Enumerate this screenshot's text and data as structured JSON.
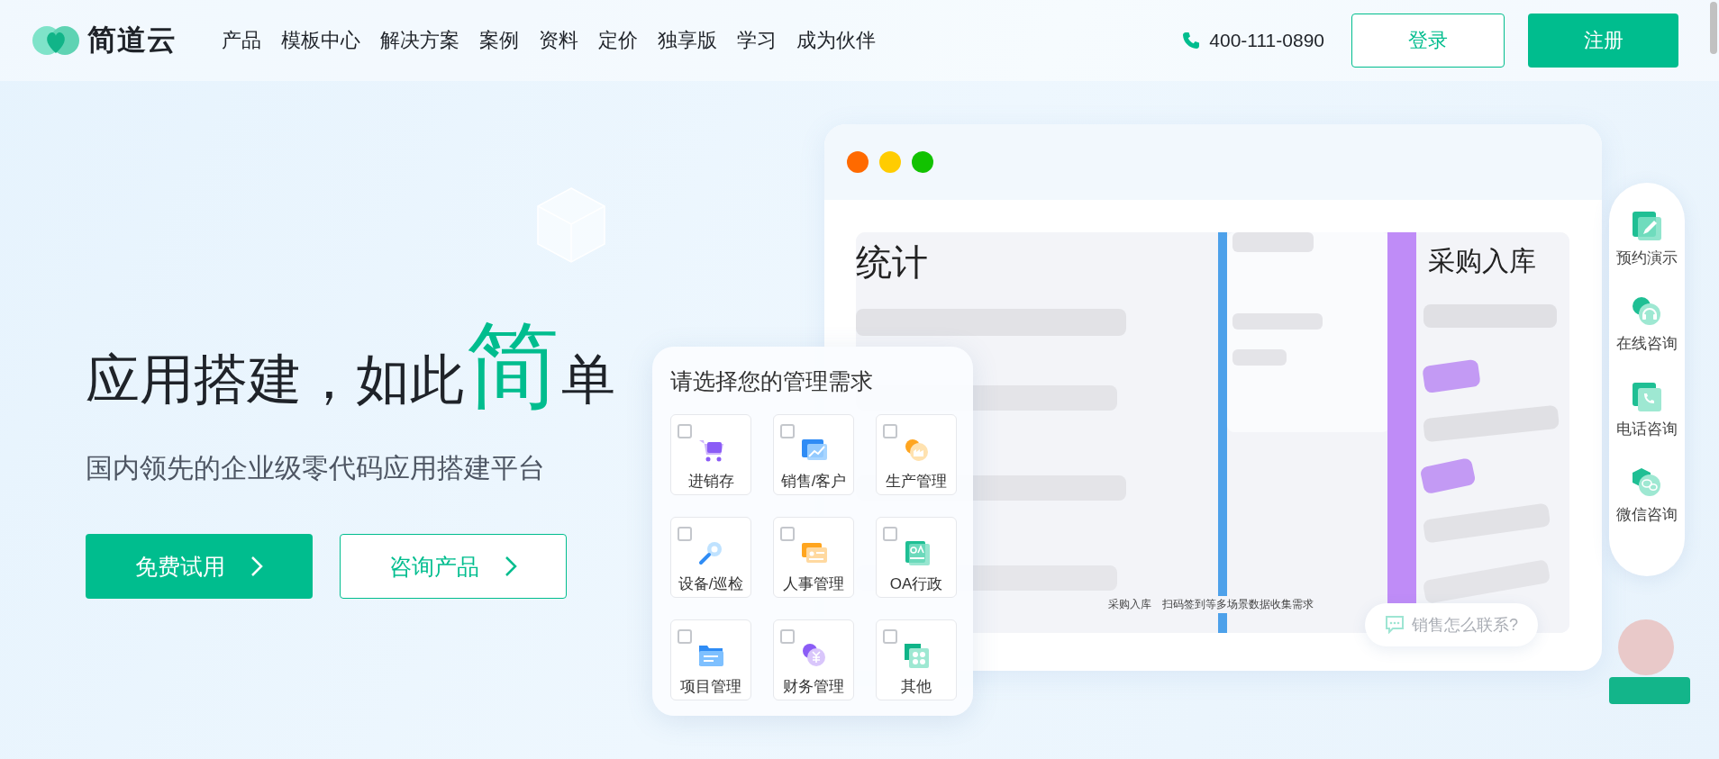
{
  "logo": {
    "text": "简道云"
  },
  "nav": [
    {
      "label": "产品"
    },
    {
      "label": "模板中心"
    },
    {
      "label": "解决方案"
    },
    {
      "label": "案例"
    },
    {
      "label": "资料"
    },
    {
      "label": "定价"
    },
    {
      "label": "独享版"
    },
    {
      "label": "学习"
    },
    {
      "label": "成为伙伴"
    }
  ],
  "phone": "400-111-0890",
  "login_button": "登录",
  "signup_button": "注册",
  "hero": {
    "title_before": "应用搭建，如此",
    "title_highlight": "简",
    "title_after": "单",
    "subtitle": "国内领先的企业级零代码应用搭建平台",
    "buttons": [
      {
        "label": "免费试用",
        "kind": "primary"
      },
      {
        "label": "咨询产品",
        "kind": "outline"
      }
    ]
  },
  "preview_window": {
    "heading_left": "统计",
    "heading_right": "采购入库",
    "caption_title": "采购入库",
    "caption_text": "扫码签到等多场景数据收集需求"
  },
  "needs_card": {
    "title": "请选择您的管理需求",
    "options": [
      {
        "label": "进销存",
        "checked": false
      },
      {
        "label": "销售/客户",
        "checked": false
      },
      {
        "label": "生产管理",
        "checked": false
      },
      {
        "label": "设备/巡检",
        "checked": false
      },
      {
        "label": "人事管理",
        "checked": false
      },
      {
        "label": "OA行政",
        "checked": false
      },
      {
        "label": "项目管理",
        "checked": false
      },
      {
        "label": "财务管理",
        "checked": false
      },
      {
        "label": "其他",
        "checked": false
      }
    ]
  },
  "side_panel": {
    "items": [
      {
        "label": "预约演示"
      },
      {
        "label": "在线咨询"
      },
      {
        "label": "电话咨询"
      },
      {
        "label": "微信咨询"
      }
    ]
  },
  "chat_bubble": {
    "text": "销售怎么联系?"
  }
}
